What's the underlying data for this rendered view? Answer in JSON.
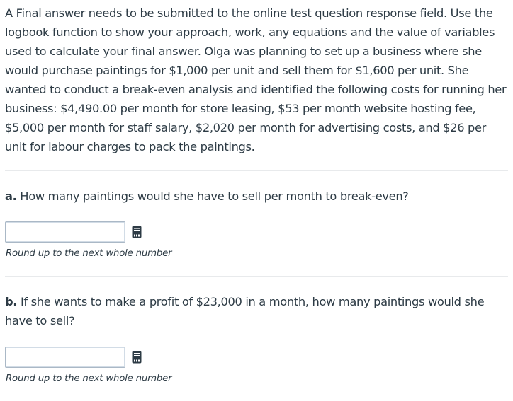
{
  "intro": {
    "text": "A Final answer needs to be submitted to the online test question response field. Use the logbook function to show your approach, work, any equations and the value of variables used to calculate your final answer. Olga was planning to set up a business where she would purchase paintings for $1,000 per unit and sell them for $1,600 per unit. She wanted to conduct a break-even analysis and identified the following costs for running her business: $4,490.00 per month for store leasing, $53 per month website hosting fee, $5,000 per month for staff salary, $2,020 per month for advertising costs, and $26 per unit for labour charges to pack the paintings."
  },
  "questions": [
    {
      "part_label": "a.",
      "text": " How many paintings would she have to sell per month to break-even?",
      "answer_value": "",
      "hint": "Round up to the next whole number",
      "icon": "logbook-icon"
    },
    {
      "part_label": "b.",
      "text": " If she wants to make a profit of $23,000 in a month, how many paintings would she have to sell?",
      "answer_value": "",
      "hint": "Round up to the next whole number",
      "icon": "logbook-icon"
    }
  ],
  "colors": {
    "text": "#2d3b45",
    "input_border": "#aab8c6",
    "divider": "#e8eaec",
    "icon": "#2d3b45"
  }
}
